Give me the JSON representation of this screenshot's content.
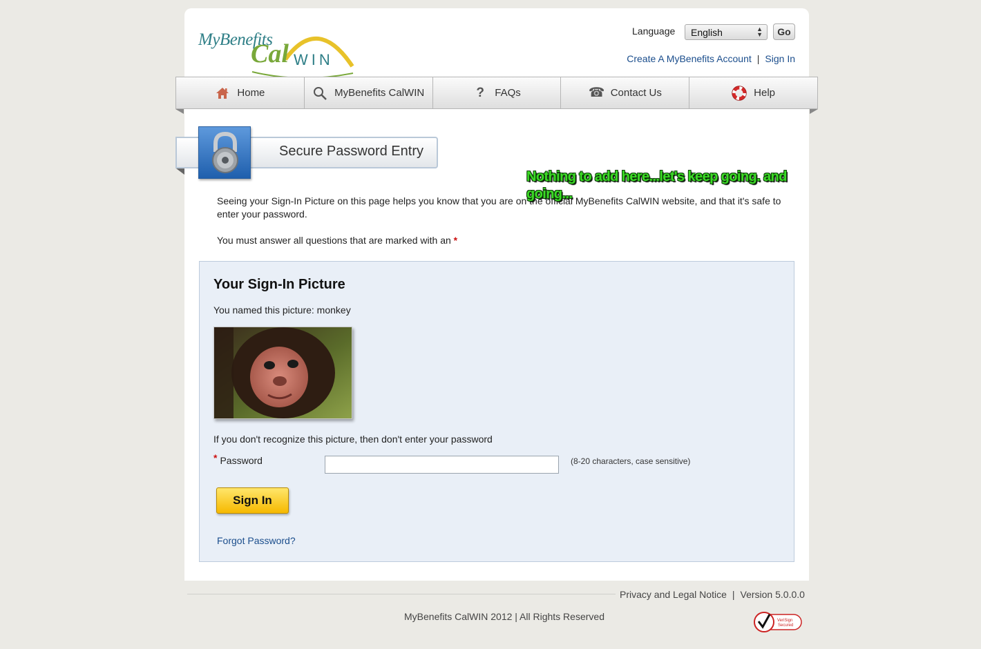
{
  "header": {
    "logo": {
      "word1": "MyBenefits",
      "word2": "Cal",
      "word3": "WIN"
    },
    "language_label": "Language",
    "language_selected": "English",
    "go_label": "Go",
    "create_account_link": "Create A MyBenefits Account",
    "link_separator": "|",
    "sign_in_link": "Sign In"
  },
  "nav": {
    "items": [
      {
        "label": "Home",
        "icon": "home-icon"
      },
      {
        "label": "MyBenefits CalWIN",
        "icon": "search-icon"
      },
      {
        "label": "FAQs",
        "icon": "question-icon"
      },
      {
        "label": "Contact Us",
        "icon": "phone-icon"
      },
      {
        "label": "Help",
        "icon": "lifebuoy-icon"
      }
    ]
  },
  "section": {
    "title": "Secure Password Entry",
    "icon": "padlock-icon"
  },
  "annotation": "Nothing to add here...let's keep going. and going...",
  "intro_text": "Seeing your Sign-In Picture on this page helps you know that you are on the official MyBenefits CalWIN website, and that it's safe to enter your password.",
  "required_note": "You must answer all questions that are marked with an",
  "required_marker": "*",
  "panel": {
    "title": "Your Sign-In Picture",
    "named_text": "You named this picture: monkey",
    "picture": "monkey-photo",
    "warning_text": "If you don't recognize this picture, then don't enter your password",
    "password_label": "Password",
    "password_value": "",
    "password_hint": "(8-20 characters, case sensitive)",
    "signin_button": "Sign In",
    "forgot_link": "Forgot Password?"
  },
  "footer": {
    "privacy_link": "Privacy and Legal Notice",
    "separator": "|",
    "version": "Version 5.0.0.0",
    "copyright": "MyBenefits CalWIN 2012 | All Rights Reserved",
    "seal": {
      "line1": "VeriSign",
      "line2": "Secured"
    }
  },
  "colors": {
    "link": "#1a4d8c",
    "required": "#cc1111",
    "button": "#f6b900",
    "panel_bg": "#e9eff7",
    "annotation": "#3cdb26"
  }
}
